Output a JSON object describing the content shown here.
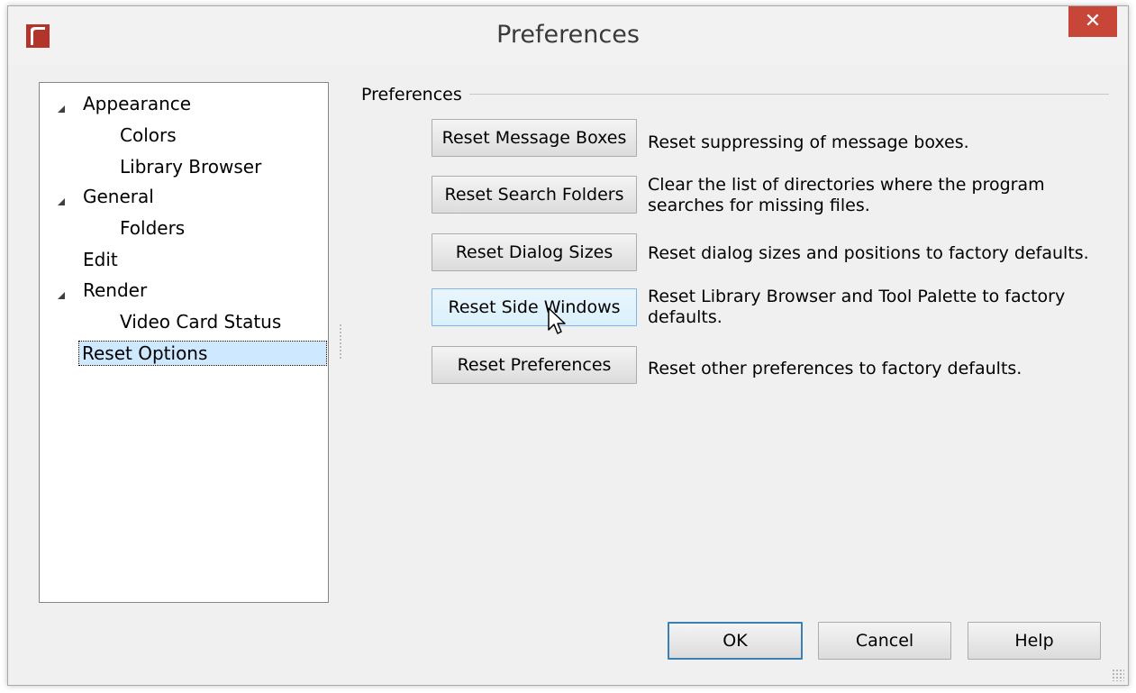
{
  "window": {
    "title": "Preferences",
    "close_symbol": "✕",
    "accent_color": "#c74638"
  },
  "tree": {
    "items": [
      {
        "label": "Appearance",
        "expanded": true
      },
      {
        "label": "Colors"
      },
      {
        "label": "Library Browser"
      },
      {
        "label": "General",
        "expanded": true
      },
      {
        "label": "Folders"
      },
      {
        "label": "Edit"
      },
      {
        "label": "Render",
        "expanded": true
      },
      {
        "label": "Video Card Status"
      },
      {
        "label": "Reset Options",
        "selected": true
      }
    ]
  },
  "group": {
    "title": "Preferences"
  },
  "resets": [
    {
      "button": "Reset Message Boxes",
      "description_lines": [
        "Reset suppressing of message boxes."
      ]
    },
    {
      "button": "Reset Search Folders",
      "description_lines": [
        "Clear the list of directories where the program",
        "searches for missing files."
      ]
    },
    {
      "button": "Reset Dialog Sizes",
      "description_lines": [
        "Reset dialog sizes and positions to factory defaults."
      ]
    },
    {
      "button": "Reset Side Windows",
      "description_lines": [
        "Reset Library Browser and Tool Palette to factory",
        "defaults."
      ]
    },
    {
      "button": "Reset Preferences",
      "description_lines": [
        "Reset other preferences to factory defaults."
      ]
    }
  ],
  "footer": {
    "ok": "OK",
    "cancel": "Cancel",
    "help": "Help"
  },
  "icons": {
    "app": "app-logo-icon",
    "tree_expanded": "expanded-triangle-icon",
    "cursor": "mouse-pointer-icon",
    "resize": "resize-grip-icon"
  }
}
